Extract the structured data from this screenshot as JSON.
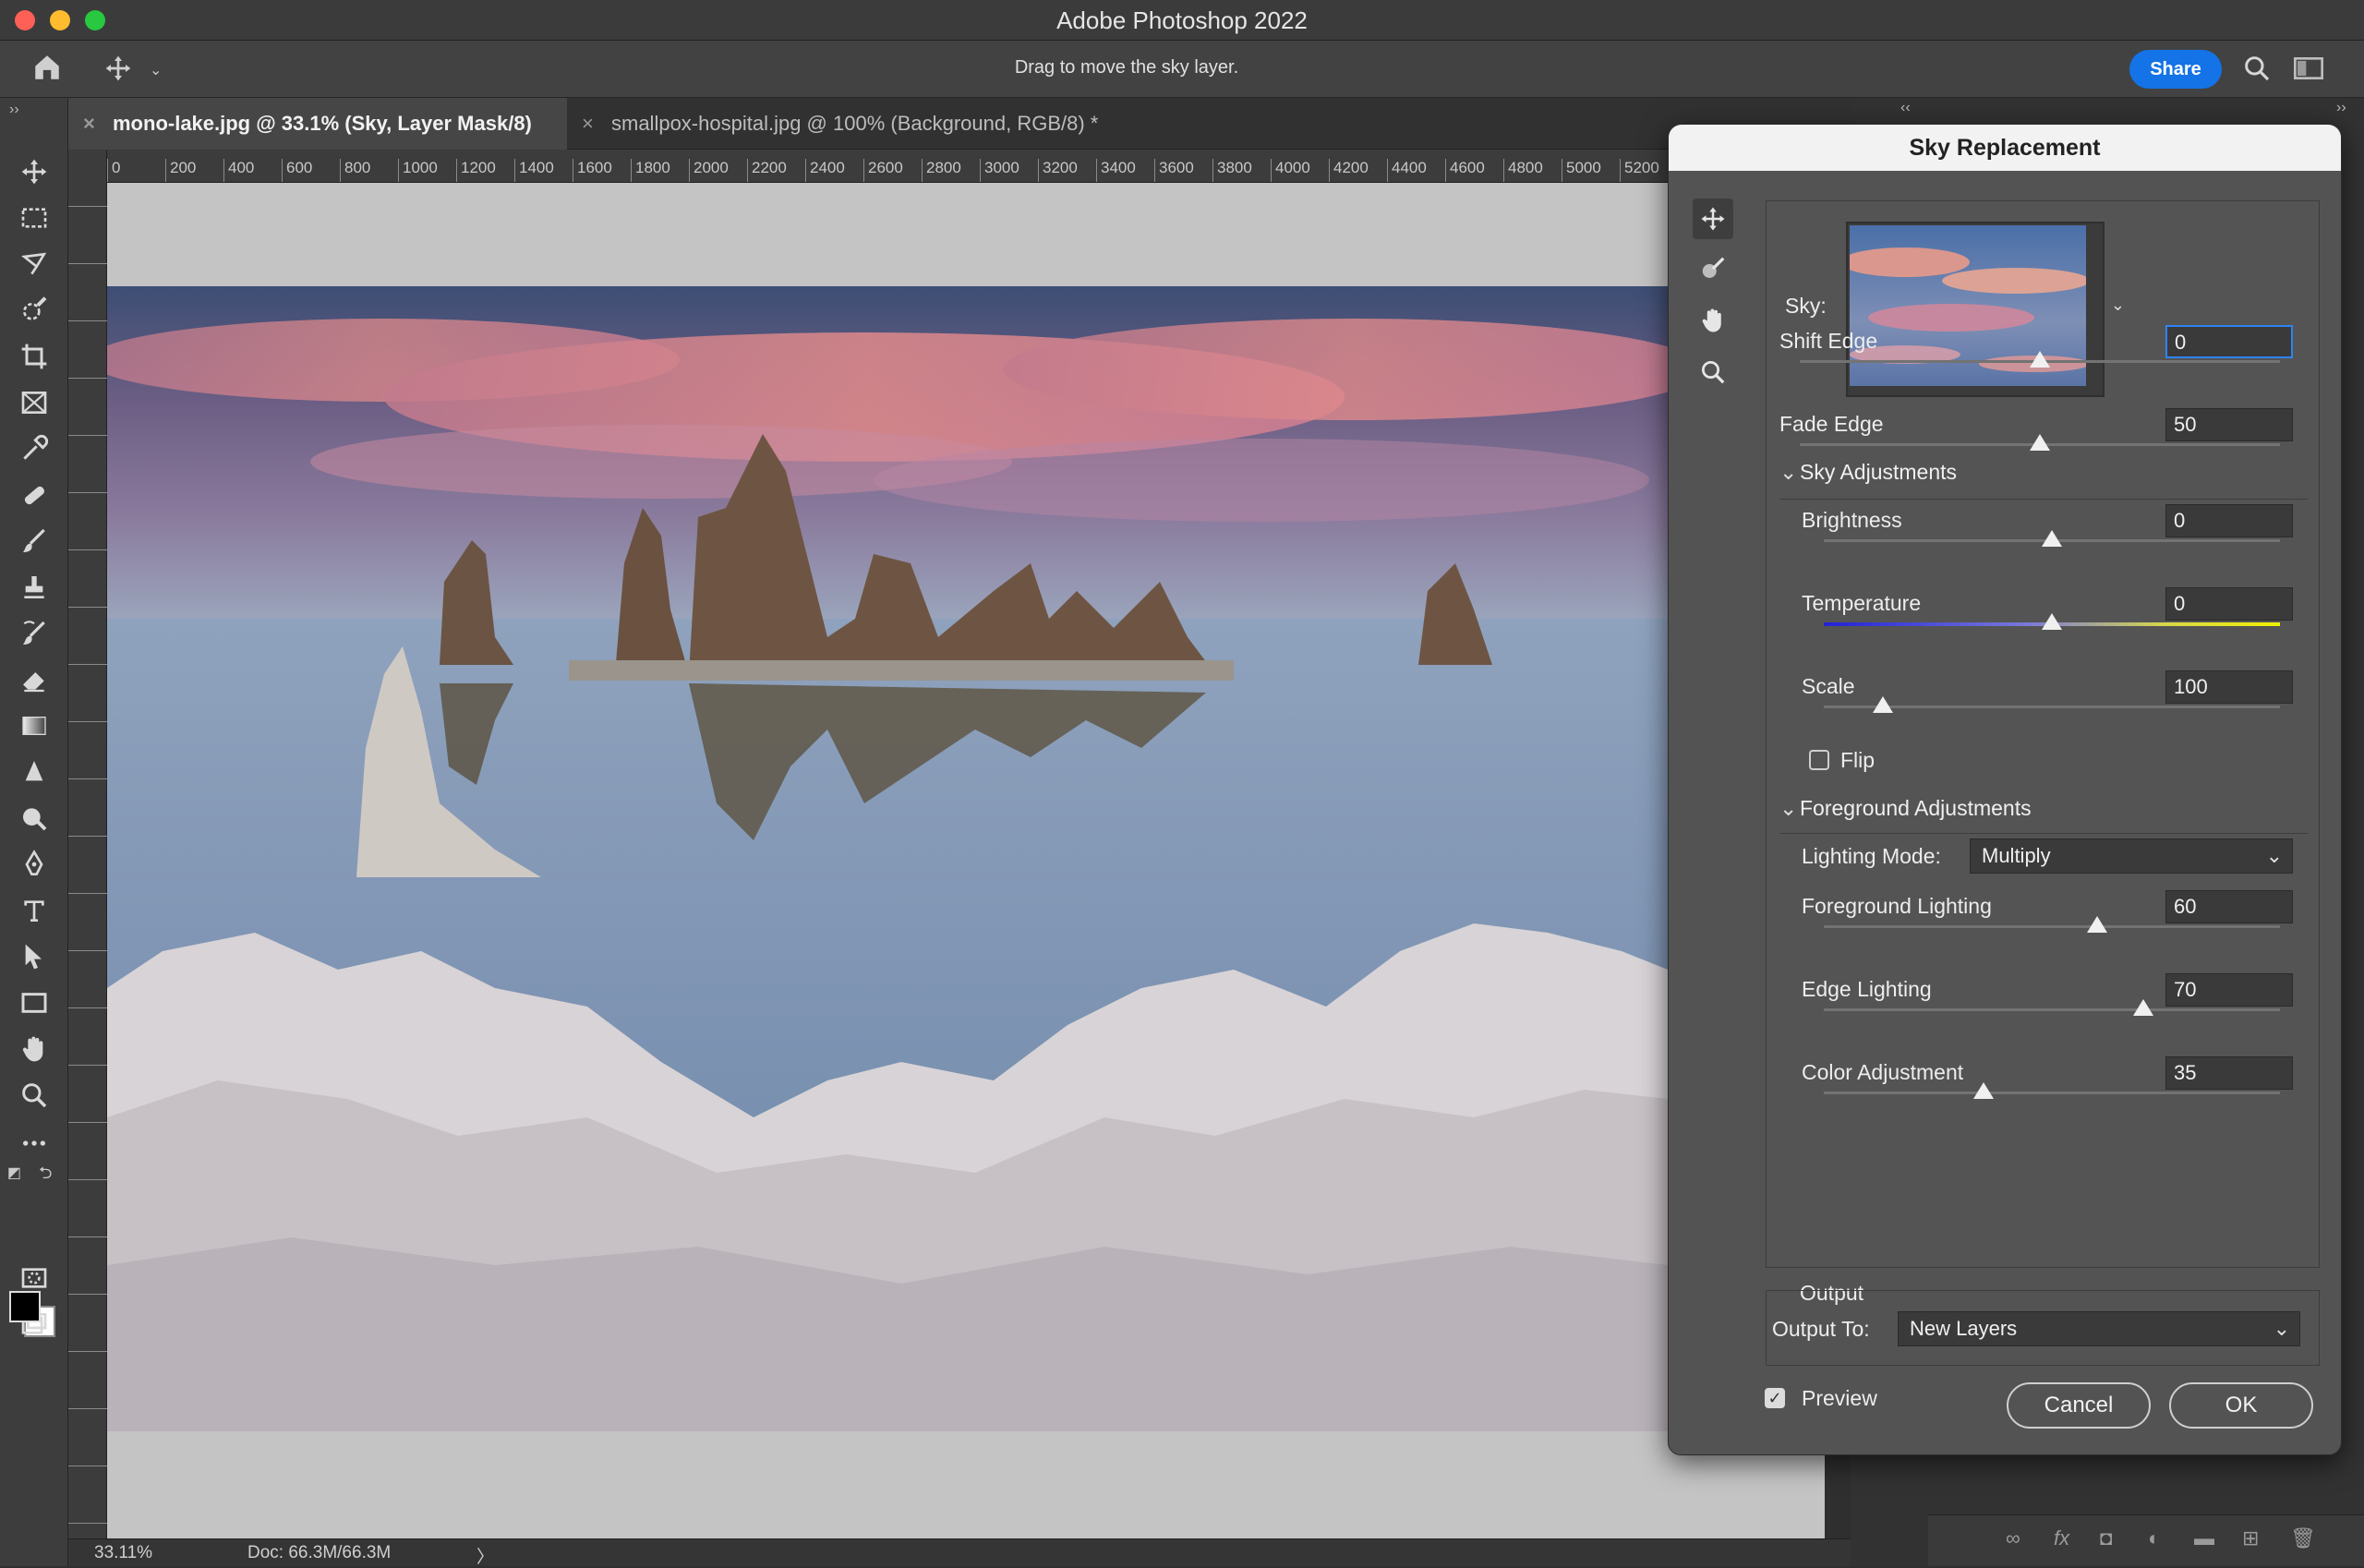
{
  "app": {
    "title": "Adobe Photoshop 2022"
  },
  "options_bar": {
    "hint": "Drag to move the sky layer.",
    "share_label": "Share"
  },
  "tabs": [
    {
      "label": "mono-lake.jpg @ 33.1% (Sky, Layer Mask/8)",
      "active": true
    },
    {
      "label": "smallpox-hospital.jpg @ 100% (Background, RGB/8) *",
      "active": false
    }
  ],
  "ruler": {
    "h_ticks": [
      "0",
      "200",
      "400",
      "600",
      "800",
      "1000",
      "1200",
      "1400",
      "1600",
      "1800",
      "2000",
      "2200",
      "2400",
      "2600",
      "2800",
      "3000",
      "3200",
      "3400",
      "3600",
      "3800",
      "4000",
      "4200",
      "4400",
      "4600",
      "4800",
      "5000",
      "5200"
    ]
  },
  "status": {
    "zoom": "33.11%",
    "doc": "Doc: 66.3M/66.3M",
    "arrow": "〉"
  },
  "dialog": {
    "title": "Sky Replacement",
    "sky_label": "Sky:",
    "shift_edge": {
      "label": "Shift Edge",
      "value": "0",
      "fraction": 0.5
    },
    "fade_edge": {
      "label": "Fade Edge",
      "value": "50",
      "fraction": 0.5
    },
    "sky_adjustments": {
      "title": "Sky Adjustments",
      "brightness": {
        "label": "Brightness",
        "value": "0",
        "fraction": 0.5
      },
      "temperature": {
        "label": "Temperature",
        "value": "0",
        "fraction": 0.5
      },
      "scale": {
        "label": "Scale",
        "value": "100",
        "fraction": 0.13
      },
      "flip": {
        "label": "Flip",
        "checked": false
      }
    },
    "foreground_adjustments": {
      "title": "Foreground Adjustments",
      "lighting_mode": {
        "label": "Lighting Mode:",
        "value": "Multiply"
      },
      "foreground_lighting": {
        "label": "Foreground Lighting",
        "value": "60",
        "fraction": 0.6
      },
      "edge_lighting": {
        "label": "Edge Lighting",
        "value": "70",
        "fraction": 0.7
      },
      "color_adjustment": {
        "label": "Color Adjustment",
        "value": "35",
        "fraction": 0.35
      }
    },
    "output": {
      "title": "Output",
      "label": "Output To:",
      "value": "New Layers"
    },
    "preview": {
      "label": "Preview",
      "checked": true
    },
    "cancel_label": "Cancel",
    "ok_label": "OK"
  },
  "colors": {
    "accent": "#1473e6",
    "panel": "#535353",
    "focus": "#2e83f3"
  }
}
